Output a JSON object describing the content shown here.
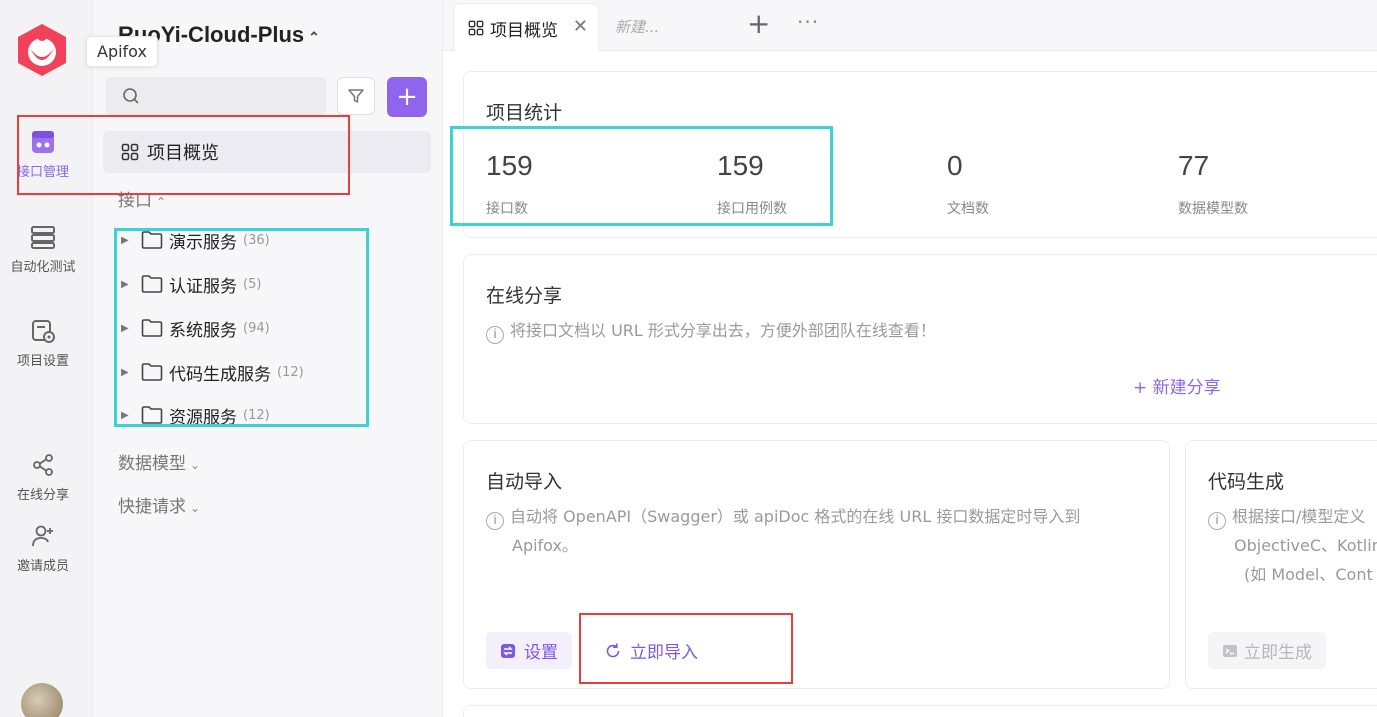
{
  "rail": {
    "tooltip": "Apifox",
    "items": [
      {
        "label": "接口管理",
        "icon": "api-management-icon",
        "active": true
      },
      {
        "label": "自动化测试",
        "icon": "automation-test-icon",
        "active": false
      },
      {
        "label": "项目设置",
        "icon": "project-settings-icon",
        "active": false
      },
      {
        "label": "在线分享",
        "icon": "share-icon",
        "active": false
      },
      {
        "label": "邀请成员",
        "icon": "invite-member-icon",
        "active": false
      }
    ],
    "accent_color": "#8c66e8"
  },
  "tree": {
    "project_name": "RuoYi-Cloud-Plus",
    "overview_label": "项目概览",
    "section_api": "接口",
    "folders": [
      {
        "name": "演示服务",
        "count": "(36)"
      },
      {
        "name": "认证服务",
        "count": "(5)"
      },
      {
        "name": "系统服务",
        "count": "(94)"
      },
      {
        "name": "代码生成服务",
        "count": "(12)"
      },
      {
        "name": "资源服务",
        "count": "(12)"
      }
    ],
    "section_models": "数据模型",
    "section_quick": "快捷请求"
  },
  "tabs": {
    "active_label": "项目概览",
    "new_placeholder": "新建..."
  },
  "stats": {
    "title": "项目统计",
    "items": [
      {
        "value": "159",
        "label": "接口数"
      },
      {
        "value": "159",
        "label": "接口用例数"
      },
      {
        "value": "0",
        "label": "文档数"
      },
      {
        "value": "77",
        "label": "数据模型数"
      }
    ]
  },
  "share": {
    "title": "在线分享",
    "desc": "将接口文档以 URL 形式分享出去，方便外部团队在线查看！",
    "new_share": "+ 新建分享"
  },
  "auto_import": {
    "title": "自动导入",
    "desc_line1": "自动将 OpenAPI（Swagger）或 apiDoc 格式的在线 URL 接口数据定时导入到",
    "desc_line2": "Apifox。",
    "settings_btn": "设置",
    "import_now_btn": "立即导入"
  },
  "codegen": {
    "title": "代码生成",
    "desc_line1": "根据接口/模型定义",
    "desc_line2": "ObjectiveC、Kotlin",
    "desc_line3": "(如 Model、Cont",
    "generate_btn": "立即生成"
  },
  "annotations": {
    "red": "#e3403f",
    "cyan": "#3dd3d3"
  }
}
